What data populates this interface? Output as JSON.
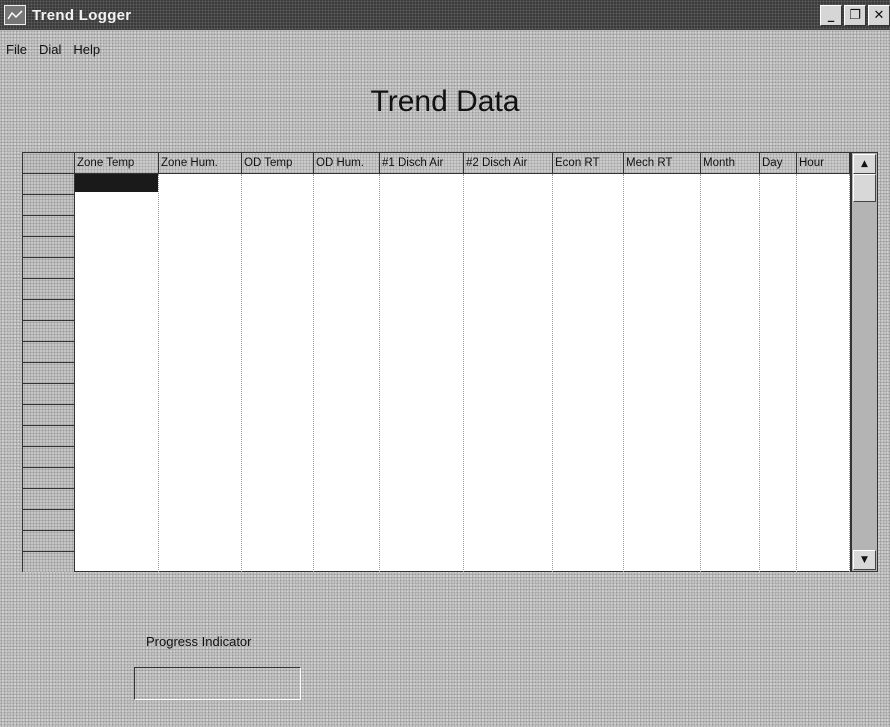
{
  "window": {
    "title": "Trend Logger",
    "controls": [
      "minimize",
      "maximize",
      "close"
    ]
  },
  "menu": [
    "File",
    "Dial",
    "Help"
  ],
  "page_title": "Trend Data",
  "table": {
    "columns": [
      "Zone Temp",
      "Zone Hum.",
      "OD Temp",
      "OD Hum.",
      "#1 Disch Air",
      "#2 Disch Air",
      "Econ RT",
      "Mech RT",
      "Month",
      "Day",
      "Hour"
    ],
    "visible_rows": 19,
    "selected_cell": {
      "row": 1,
      "column": "Zone Temp"
    },
    "rows": []
  },
  "progress": {
    "label": "Progress Indicator",
    "fraction": 0
  },
  "icons": {
    "app": "chart-icon",
    "scroll_up": "arrow-up-icon",
    "scroll_down": "arrow-down-icon"
  }
}
